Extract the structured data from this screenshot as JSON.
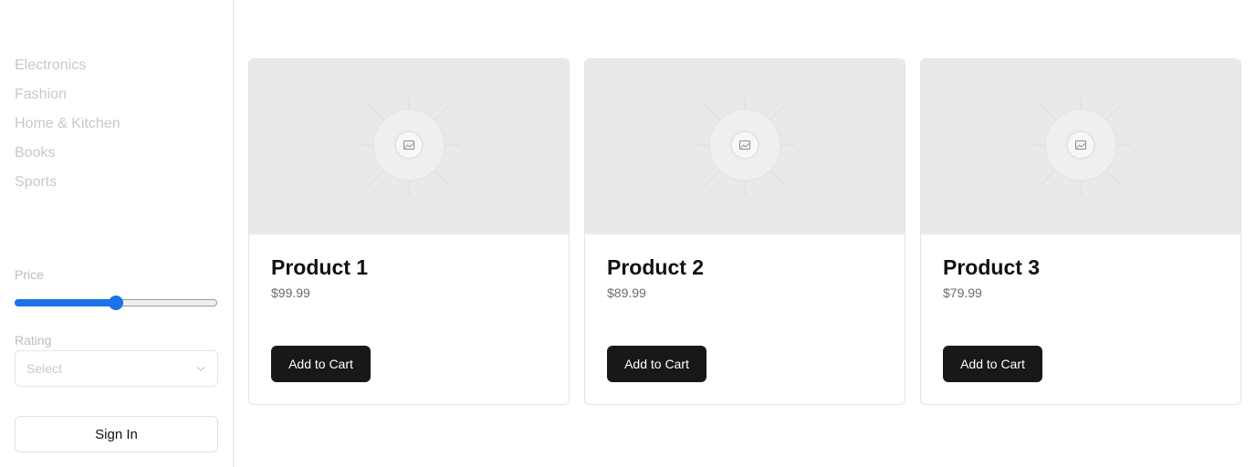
{
  "sidebar": {
    "categories": [
      "Electronics",
      "Fashion",
      "Home & Kitchen",
      "Books",
      "Sports"
    ],
    "price_label": "Price",
    "price_fraction": 0.5,
    "rating_label": "Rating",
    "rating_placeholder": "Select",
    "signin_label": "Sign In"
  },
  "products": [
    {
      "name": "Product 1",
      "price": "$99.99",
      "button": "Add to Cart"
    },
    {
      "name": "Product 2",
      "price": "$89.99",
      "button": "Add to Cart"
    },
    {
      "name": "Product 3",
      "price": "$79.99",
      "button": "Add to Cart"
    }
  ],
  "icons": {
    "image_placeholder": "image-placeholder-icon",
    "select_chevron": "chevron-down-icon"
  },
  "colors": {
    "accent": "#1a73e8",
    "button_dark": "#18181b"
  }
}
